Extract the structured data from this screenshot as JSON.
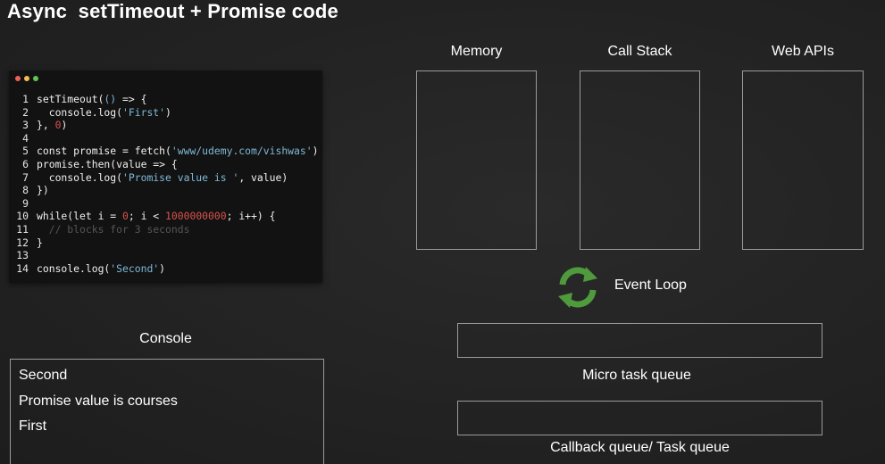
{
  "title": "Async  setTimeout + Promise code",
  "editor": {
    "dot_colors": [
      "#ed5f57",
      "#f5bd4f",
      "#61c454"
    ],
    "lines": [
      {
        "n": "1",
        "parts": [
          {
            "t": "setTimeout(",
            "c": "src"
          },
          {
            "t": "()",
            "c": "str"
          },
          {
            "t": " => {",
            "c": "src"
          }
        ]
      },
      {
        "n": "2",
        "parts": [
          {
            "t": "  console.log(",
            "c": "src"
          },
          {
            "t": "'First'",
            "c": "str"
          },
          {
            "t": ")",
            "c": "src"
          }
        ]
      },
      {
        "n": "3",
        "parts": [
          {
            "t": "}, ",
            "c": "src"
          },
          {
            "t": "0",
            "c": "num"
          },
          {
            "t": ")",
            "c": "src"
          }
        ]
      },
      {
        "n": "4",
        "parts": []
      },
      {
        "n": "5",
        "parts": [
          {
            "t": "const promise = fetch(",
            "c": "src"
          },
          {
            "t": "'www/udemy.com/vishwas'",
            "c": "str"
          },
          {
            "t": ")",
            "c": "src"
          }
        ]
      },
      {
        "n": "6",
        "parts": [
          {
            "t": "promise.then(value => {",
            "c": "src"
          }
        ]
      },
      {
        "n": "7",
        "parts": [
          {
            "t": "  console.log(",
            "c": "src"
          },
          {
            "t": "'Promise value is '",
            "c": "str"
          },
          {
            "t": ", value)",
            "c": "src"
          }
        ]
      },
      {
        "n": "8",
        "parts": [
          {
            "t": "})",
            "c": "src"
          }
        ]
      },
      {
        "n": "9",
        "parts": []
      },
      {
        "n": "10",
        "parts": [
          {
            "t": "while(let i = ",
            "c": "src"
          },
          {
            "t": "0",
            "c": "num"
          },
          {
            "t": "; i < ",
            "c": "src"
          },
          {
            "t": "1000000000",
            "c": "num"
          },
          {
            "t": "; i++) {",
            "c": "src"
          }
        ]
      },
      {
        "n": "11",
        "parts": [
          {
            "t": "  // blocks for 3 seconds",
            "c": "cmt"
          }
        ]
      },
      {
        "n": "12",
        "parts": [
          {
            "t": "}",
            "c": "src"
          }
        ]
      },
      {
        "n": "13",
        "parts": []
      },
      {
        "n": "14",
        "parts": [
          {
            "t": "console.log(",
            "c": "src"
          },
          {
            "t": "'Second'",
            "c": "str"
          },
          {
            "t": ")",
            "c": "src"
          }
        ]
      }
    ]
  },
  "panels": {
    "memory_label": "Memory",
    "call_stack_label": "Call Stack",
    "web_apis_label": "Web APIs",
    "event_loop_label": "Event Loop",
    "microtask_label": "Micro task queue",
    "callback_label": "Callback queue/ Task queue",
    "console_label": "Console"
  },
  "console": {
    "lines": [
      "Second",
      "Promise value is courses",
      "First"
    ]
  },
  "colors": {
    "background": "#232323",
    "box_border": "#9a9a9a",
    "event_loop_green": "#4f9a3c"
  },
  "icons": {
    "event_loop": "refresh-arrows-icon"
  }
}
